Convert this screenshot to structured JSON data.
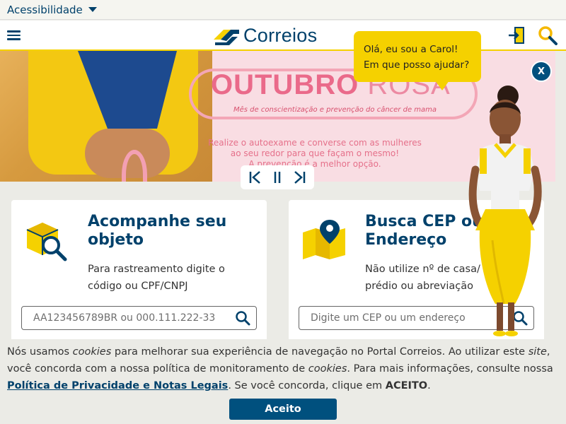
{
  "accessibility": {
    "label": "Acessibilidade"
  },
  "header": {
    "logo_text": "Correios"
  },
  "banner": {
    "title_bold": "OUTUBRO",
    "title_light": "ROSA",
    "subtitle": "Mês de conscientização e prevenção do câncer de mama",
    "message_line1": "Realize o autoexame e converse com as mulheres",
    "message_line2": "ao seu redor para que façam o mesmo!",
    "message_line3": "A prevenção é a melhor opção."
  },
  "chat": {
    "line1": "Olá, eu sou a Carol!",
    "line2": "Em que posso ajudar?",
    "close_label": "X"
  },
  "cards": {
    "tracking": {
      "title": "Acompanhe seu objeto",
      "description": "Para rastreamento digite o código ou CPF/CNPJ",
      "placeholder": "AA123456789BR ou 000.111.222-33"
    },
    "cep": {
      "title": "Busca CEP ou Endereço",
      "description": "Não utilize nº de casa/ lote/ prédio ou abreviação",
      "placeholder": "Digite um CEP ou um endereço"
    }
  },
  "cookie": {
    "text_1": "Nós usamos ",
    "cookies_word": "cookies",
    "text_2": " para melhorar sua experiência de navegação no Portal Correios. Ao utilizar este ",
    "site_word": "site",
    "text_3": ", você concorda com a nossa política de monitoramento de ",
    "cookies_word_2": "cookies",
    "text_4": ". Para mais informações, consulte nossa ",
    "policy_link": "Política de Privacidade e Notas Legais",
    "text_5": ". Se você concorda, clique em ",
    "accept_word": "ACEITO",
    "text_6": ".",
    "button_label": "Aceito"
  },
  "colors": {
    "brand_blue": "#00416b",
    "brand_yellow": "#f5d100",
    "button_blue": "#00507e",
    "banner_pink": "#ea6a8a"
  },
  "icons": {
    "menu": "hamburger-icon",
    "login": "login-icon",
    "search": "search-icon",
    "package": "package-search-icon",
    "map": "map-pin-icon",
    "prev": "skip-back-icon",
    "pause": "pause-icon",
    "next": "skip-forward-icon"
  }
}
